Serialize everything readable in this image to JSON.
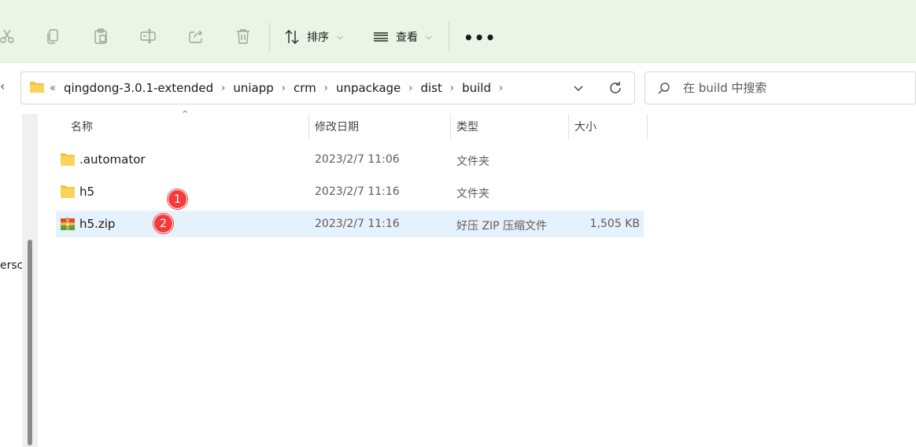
{
  "toolbar": {
    "icons": [
      "cut-icon",
      "copy-icon",
      "paste-icon",
      "rename-icon",
      "share-icon",
      "delete-icon"
    ],
    "sort_label": "排序",
    "view_label": "查看",
    "more_label": "•••"
  },
  "address": {
    "overflow": "«",
    "crumbs": [
      "qingdong-3.0.1-extended",
      "uniapp",
      "crm",
      "unpackage",
      "dist",
      "build"
    ],
    "separator": "›"
  },
  "search": {
    "placeholder": "在 build 中搜索"
  },
  "nav": {
    "partial_text": "ersc"
  },
  "columns": {
    "name": "名称",
    "modified": "修改日期",
    "type": "类型",
    "size": "大小"
  },
  "files": [
    {
      "name": ".automator",
      "modified": "2023/2/7 11:06",
      "type": "文件夹",
      "size": "",
      "icon": "folder-icon",
      "selected": false
    },
    {
      "name": "h5",
      "modified": "2023/2/7 11:16",
      "type": "文件夹",
      "size": "",
      "icon": "folder-icon",
      "selected": false
    },
    {
      "name": "h5.zip",
      "modified": "2023/2/7 11:16",
      "type": "好压 ZIP 压缩文件",
      "size": "1,505 KB",
      "icon": "zip-archive-icon",
      "selected": true
    }
  ],
  "annotations": {
    "badge_1": "1",
    "badge_2": "2"
  },
  "colors": {
    "toolbar_bg": "#ebf5e5",
    "selected_row": "#e5f1fb",
    "badge": "#f43b3b",
    "folder": "#f5c242"
  }
}
